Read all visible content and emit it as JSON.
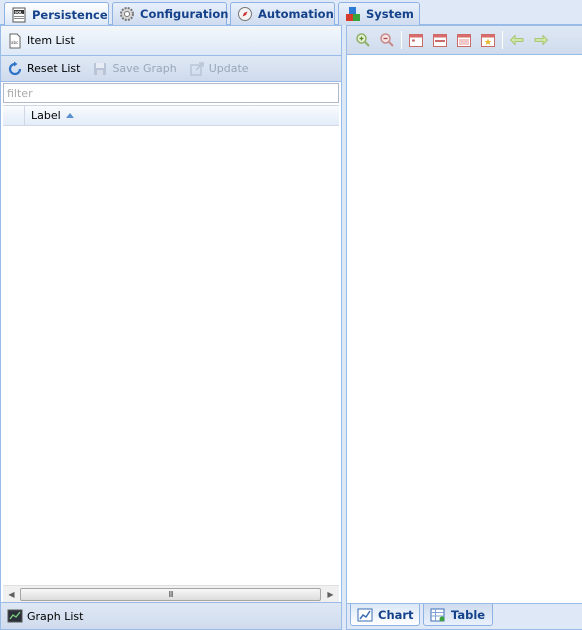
{
  "top_tabs": [
    {
      "label": "Persistence",
      "icon": "sql-database-icon",
      "active": true
    },
    {
      "label": "Configuration",
      "icon": "gear-icon",
      "active": false
    },
    {
      "label": "Automation",
      "icon": "compass-icon",
      "active": false
    },
    {
      "label": "System",
      "icon": "blocks-icon",
      "active": false
    }
  ],
  "left_panel": {
    "header": {
      "title": "Item List",
      "icon": "document-icon"
    },
    "toolbar": {
      "reset_label": "Reset List",
      "save_label": "Save Graph",
      "update_label": "Update"
    },
    "filter": {
      "placeholder": "filter",
      "value": ""
    },
    "grid": {
      "column_label": "Label",
      "sort": "ascending",
      "rows": []
    },
    "scrollbar_grip": "III",
    "footer": {
      "title": "Graph List",
      "icon": "graph-icon"
    }
  },
  "right_panel": {
    "toolbar_icons": [
      "zoom-in-icon",
      "zoom-out-icon",
      "calendar-day-icon",
      "calendar-week-icon",
      "calendar-month-icon",
      "calendar-star-icon",
      "arrow-left-icon",
      "arrow-right-icon"
    ],
    "bottom_tabs": [
      {
        "label": "Chart",
        "icon": "chart-icon",
        "active": true
      },
      {
        "label": "Table",
        "icon": "table-icon",
        "active": false
      }
    ]
  },
  "colors": {
    "accent": "#15428b",
    "panel_border": "#99bbe8",
    "background": "#dfe8f6"
  }
}
